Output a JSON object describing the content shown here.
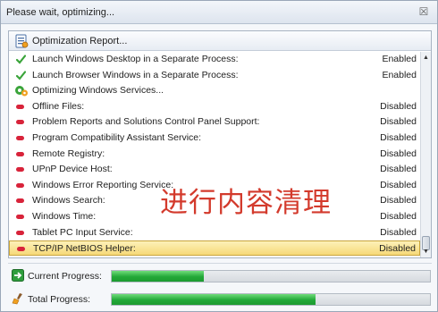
{
  "window": {
    "title": "Please wait, optimizing...",
    "close_glyph": "☒"
  },
  "report": {
    "header_label": "Optimization Report...",
    "header_icon": "report-icon"
  },
  "rows": [
    {
      "type": "item",
      "icon": "check-icon",
      "label": "Launch Windows Desktop in a Separate Process:",
      "status": "Enabled"
    },
    {
      "type": "item",
      "icon": "check-icon",
      "label": "Launch Browser Windows in a Separate Process:",
      "status": "Enabled"
    },
    {
      "type": "section",
      "icon": "services-icon",
      "label": "Optimizing Windows Services...",
      "status": ""
    },
    {
      "type": "item",
      "icon": "disabled-icon",
      "label": "Offline Files:",
      "status": "Disabled"
    },
    {
      "type": "item",
      "icon": "disabled-icon",
      "label": "Problem Reports and Solutions Control Panel Support:",
      "status": "Disabled"
    },
    {
      "type": "item",
      "icon": "disabled-icon",
      "label": "Program Compatibility Assistant Service:",
      "status": "Disabled"
    },
    {
      "type": "item",
      "icon": "disabled-icon",
      "label": "Remote Registry:",
      "status": "Disabled"
    },
    {
      "type": "item",
      "icon": "disabled-icon",
      "label": "UPnP Device Host:",
      "status": "Disabled"
    },
    {
      "type": "item",
      "icon": "disabled-icon",
      "label": "Windows Error Reporting Service:",
      "status": "Disabled"
    },
    {
      "type": "item",
      "icon": "disabled-icon",
      "label": "Windows Search:",
      "status": "Disabled"
    },
    {
      "type": "item",
      "icon": "disabled-icon",
      "label": "Windows Time:",
      "status": "Disabled"
    },
    {
      "type": "item",
      "icon": "disabled-icon",
      "label": "Tablet PC Input Service:",
      "status": "Disabled"
    },
    {
      "type": "item",
      "icon": "disabled-icon",
      "label": "TCP/IP NetBIOS Helper:",
      "status": "Disabled",
      "selected": true
    }
  ],
  "overlay_caption": "进行内容清理",
  "progress": {
    "current": {
      "label": "Current Progress:",
      "icon": "arrow-right-icon",
      "fraction": 0.29
    },
    "total": {
      "label": "Total Progress:",
      "icon": "broom-icon",
      "fraction": 0.64
    }
  },
  "colors": {
    "accent_green": "#22a838",
    "disabled_red": "#d8233a",
    "check_green": "#3aa43a",
    "highlight": "#f6d979",
    "overlay_red": "#d33a2c"
  }
}
